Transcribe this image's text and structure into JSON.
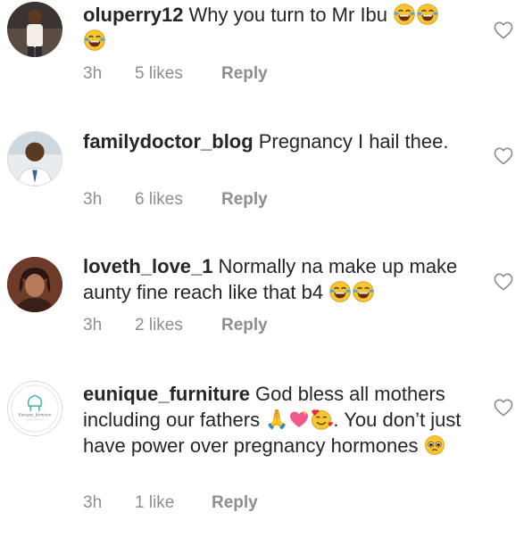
{
  "comments": [
    {
      "username": "oluperry12",
      "text": "Why you turn to Mr Ibu",
      "emojis_after_text": [
        "face-with-tears-of-joy",
        "face-with-tears-of-joy",
        "face-with-tears-of-joy"
      ],
      "time": "3h",
      "likes": "5 likes",
      "reply": "Reply"
    },
    {
      "username": "familydoctor_blog",
      "text": "Pregnancy I hail thee.",
      "time": "3h",
      "likes": "6 likes",
      "reply": "Reply"
    },
    {
      "username": "loveth_love_1",
      "text": "Normally na make up make aunty fine reach like that b4",
      "emojis_after_text": [
        "face-with-tears-of-joy",
        "face-with-tears-of-joy"
      ],
      "time": "3h",
      "likes": "2 likes",
      "reply": "Reply"
    },
    {
      "username": "eunique_furniture",
      "text_part1": "God bless all mothers including our fathers",
      "emojis_mid": [
        "folded-hands",
        "sparkling-heart",
        "smiling-face-with-hearts"
      ],
      "text_part2": ". You don’t just have power over pregnancy hormones",
      "emojis_after_text": [
        "pleading-face"
      ],
      "avatar_text": "Eunique_furniture",
      "time": "3h",
      "likes": "1 like",
      "reply": "Reply"
    }
  ],
  "icons": {
    "like": "heart-outline-icon"
  },
  "colors": {
    "text": "#262626",
    "meta": "#8e8e8e",
    "emoji": "#f7c531"
  }
}
